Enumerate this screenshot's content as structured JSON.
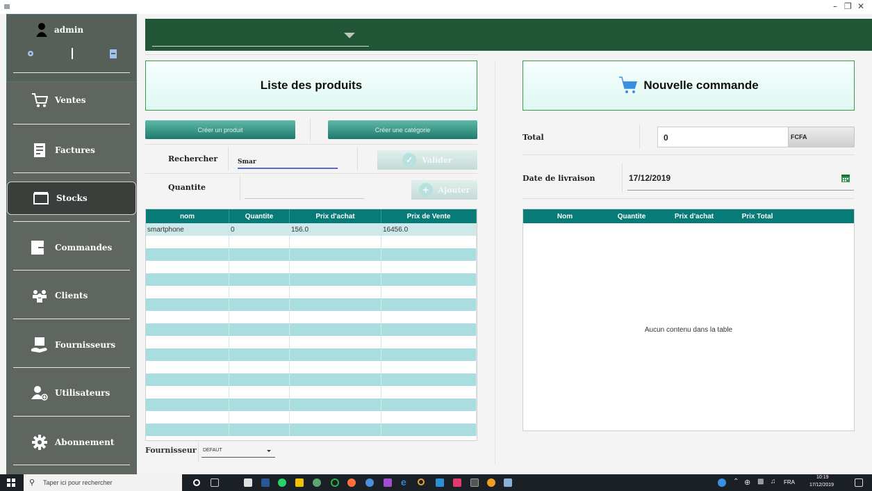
{
  "user": {
    "name": "admin"
  },
  "nav": [
    {
      "label": "Ventes",
      "icon": "cart-icon"
    },
    {
      "label": "Factures",
      "icon": "invoice-icon"
    },
    {
      "label": "Stocks",
      "icon": "box-icon",
      "active": true
    },
    {
      "label": "Commandes",
      "icon": "order-icon"
    },
    {
      "label": "Clients",
      "icon": "clients-icon"
    },
    {
      "label": "Fournisseurs",
      "icon": "supplier-icon"
    },
    {
      "label": "Utilisateurs",
      "icon": "add-user-icon"
    },
    {
      "label": "Abonnement",
      "icon": "gear-icon"
    }
  ],
  "products": {
    "title": "Liste des produits",
    "create_product": "Créer un produit",
    "create_category": "Créer une catégorie",
    "search_label": "Rechercher",
    "search_value": "Smar",
    "validate": "Valider",
    "quantity_label": "Quantite",
    "add": "Ajouter",
    "columns": [
      "nom",
      "Quantite",
      "Prix d'achat",
      "Prix de Vente"
    ],
    "rows": [
      [
        "smartphone",
        "0",
        "156.0",
        "16456.0"
      ]
    ],
    "supplier_label": "Fournisseur",
    "supplier_value": "DEFAUT"
  },
  "order": {
    "title": "Nouvelle commande",
    "total_label": "Total",
    "total_value": "0",
    "currency": "FCFA",
    "date_label": "Date de livraison",
    "date_value": "17/12/2019",
    "columns": [
      "Nom",
      "Quantite",
      "Prix d'achat",
      "Prix Total"
    ],
    "empty": "Aucun contenu dans la table"
  },
  "taskbar": {
    "search_placeholder": "Taper ici pour rechercher",
    "lang": "FRA",
    "time": "10:19",
    "date": "17/12/2019"
  },
  "colors": {
    "topbar": "#215737",
    "sidebar": "#5f655f",
    "table_header": "#067b77"
  }
}
